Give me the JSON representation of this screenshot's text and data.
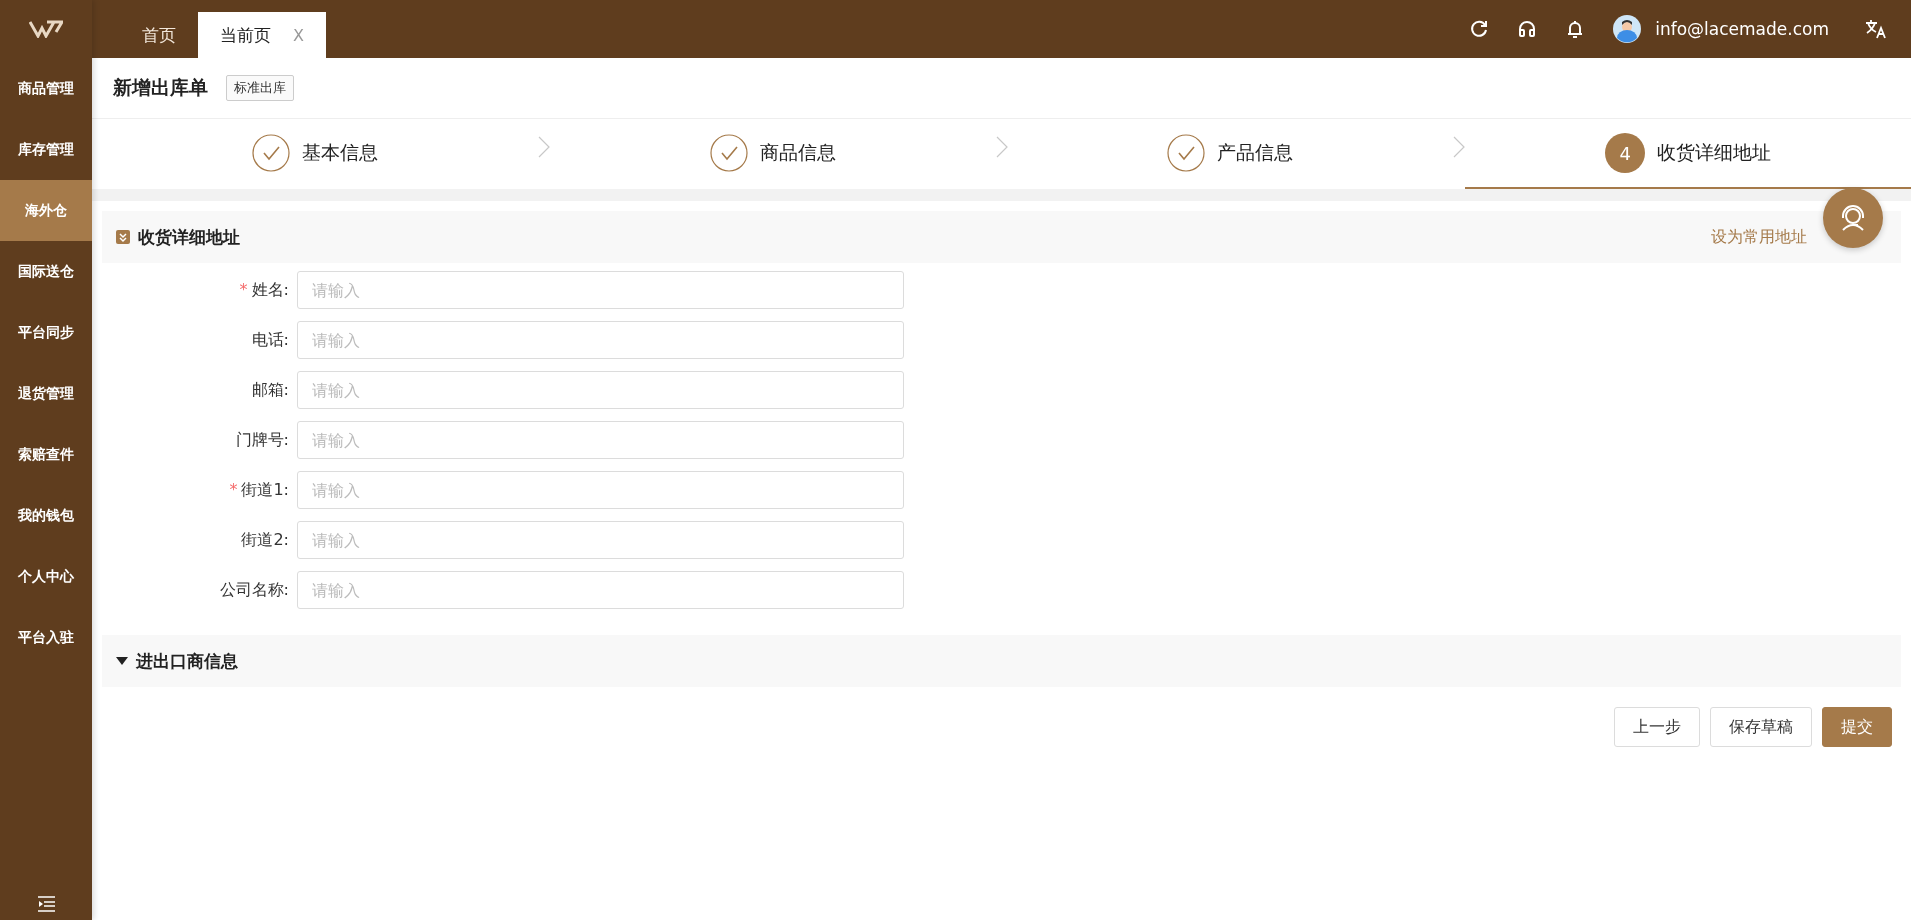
{
  "topbar": {
    "tabs": [
      {
        "label": "首页",
        "selected": false
      },
      {
        "label": "当前页",
        "selected": true,
        "close": "X"
      }
    ],
    "user": {
      "email": "info@lacemade.com"
    }
  },
  "sidebar": {
    "items": [
      {
        "label": "商品管理",
        "selected": false
      },
      {
        "label": "库存管理",
        "selected": false
      },
      {
        "label": "海外仓",
        "selected": true
      },
      {
        "label": "国际送仓",
        "selected": false
      },
      {
        "label": "平台同步",
        "selected": false
      },
      {
        "label": "退货管理",
        "selected": false
      },
      {
        "label": "索赔查件",
        "selected": false
      },
      {
        "label": "我的钱包",
        "selected": false
      },
      {
        "label": "个人中心",
        "selected": false
      },
      {
        "label": "平台入驻",
        "selected": false
      }
    ]
  },
  "page": {
    "title": "新增出库单",
    "tag": "标准出库"
  },
  "steps": [
    {
      "label": "基本信息",
      "done": true,
      "selected": false
    },
    {
      "label": "商品信息",
      "done": true,
      "selected": false
    },
    {
      "label": "产品信息",
      "done": true,
      "selected": false
    },
    {
      "label": "收货详细地址",
      "done": false,
      "selected": true,
      "number": "4"
    }
  ],
  "sections": [
    {
      "title": "收货详细地址",
      "expanded": true,
      "action": "设为常用地址",
      "fields": [
        {
          "label": "姓名:",
          "required_mark": "*",
          "placeholder": "请输入"
        },
        {
          "label": "电话:",
          "placeholder": "请输入"
        },
        {
          "label": "邮箱:",
          "placeholder": "请输入"
        },
        {
          "label": "门牌号:",
          "placeholder": "请输入"
        },
        {
          "label": "街道1:",
          "required_mark": "*",
          "placeholder": "请输入"
        },
        {
          "label": "街道2:",
          "placeholder": "请输入"
        },
        {
          "label": "公司名称:",
          "placeholder": "请输入"
        }
      ]
    },
    {
      "title": "进出口商信息",
      "expanded": false
    }
  ],
  "buttons": [
    {
      "label": "上一步",
      "kind": "default"
    },
    {
      "label": "保存草稿",
      "kind": "default"
    },
    {
      "label": "提交",
      "kind": "primary"
    }
  ]
}
